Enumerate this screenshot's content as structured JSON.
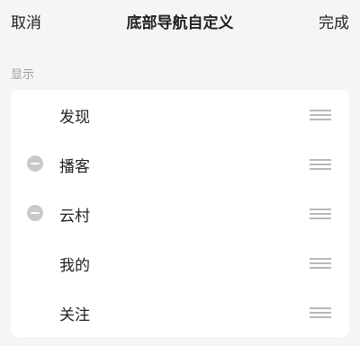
{
  "header": {
    "cancel_label": "取消",
    "title": "底部导航自定义",
    "done_label": "完成"
  },
  "section": {
    "label": "显示"
  },
  "items": [
    {
      "label": "发现",
      "removable": false
    },
    {
      "label": "播客",
      "removable": true
    },
    {
      "label": "云村",
      "removable": true
    },
    {
      "label": "我的",
      "removable": false
    },
    {
      "label": "关注",
      "removable": false
    }
  ],
  "icons": {
    "remove": "minus-circle-icon",
    "drag": "drag-handle-icon"
  },
  "colors": {
    "background": "#f5f5f7",
    "card": "#ffffff",
    "text": "#222222",
    "muted": "#9a9a9a",
    "remove_icon": "#c9c9c9",
    "drag_handle": "#b8b8b8"
  }
}
